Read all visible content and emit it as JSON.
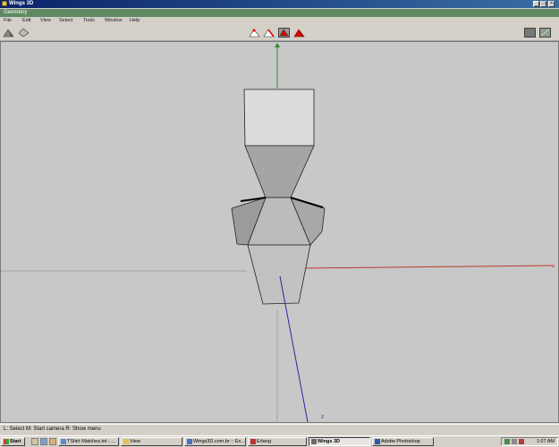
{
  "window": {
    "title": "Wings 3D",
    "min_glyph": "_",
    "max_glyph": "□",
    "close_glyph": "×"
  },
  "geometry_bar": {
    "label": "Geometry"
  },
  "menu": {
    "items": [
      "File",
      "Edit",
      "View",
      "Select",
      "Tools",
      "Window",
      "Help"
    ]
  },
  "toolbar": {
    "view_buttons": [
      "ground-plane-icon",
      "axes-toggle-icon"
    ],
    "selection_modes": [
      "vertex-mode-icon",
      "edge-mode-icon",
      "face-mode-icon",
      "body-mode-icon"
    ],
    "active_mode": "face-mode-icon",
    "right_buttons": [
      "workmode-icon",
      "perspective-icon"
    ]
  },
  "viewport": {
    "axis_labels": {
      "z": "z"
    },
    "colors": {
      "background": "#c8c8c8",
      "x_axis": "#c0392b",
      "y_axis": "#2e8b2e",
      "z_axis": "#2a2a9a",
      "mesh_edge": "#222222"
    }
  },
  "status": {
    "text": "L: Select   M: Start camera   R: Show menu"
  },
  "taskbar": {
    "start_label": "Start",
    "tasks": [
      {
        "label": "TShirt Matches.txt - ..."
      },
      {
        "label": "View"
      },
      {
        "label": "Wings3D.com.br :: Ex..."
      },
      {
        "label": "Erlang"
      },
      {
        "label": "Wings 3D",
        "active": true
      },
      {
        "label": "Adobe Photoshop"
      }
    ],
    "clock": "1:07 AM"
  }
}
